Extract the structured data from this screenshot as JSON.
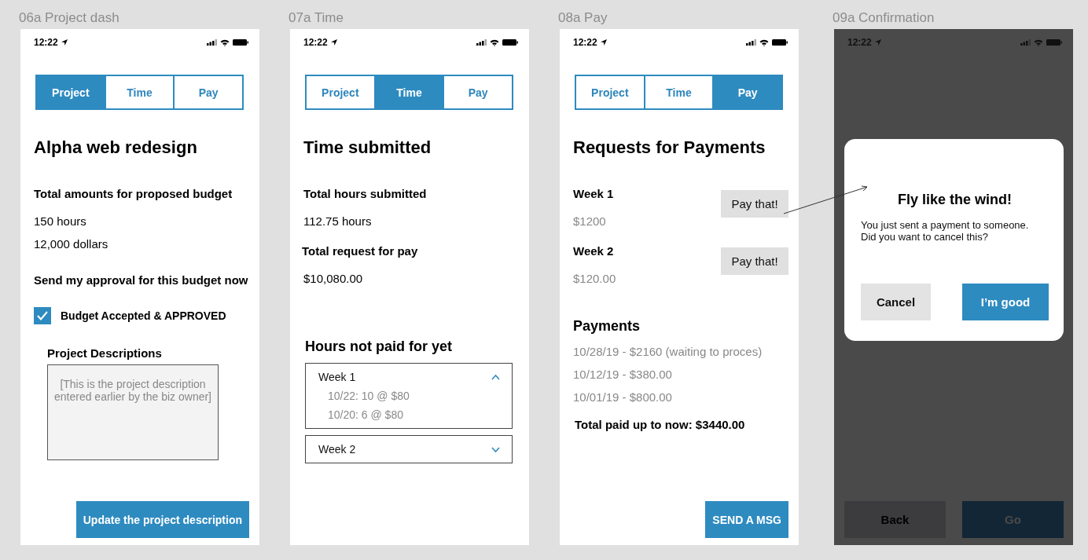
{
  "artboards": [
    {
      "label": "06a Project dash",
      "kind": "project",
      "overlay": false,
      "status_time": "12:22",
      "tabs": [
        {
          "label": "Project",
          "selected": true
        },
        {
          "label": "Time",
          "selected": false
        },
        {
          "label": "Pay",
          "selected": false
        }
      ],
      "title": "Alpha web redesign",
      "budget_heading": "Total amounts for proposed budget",
      "budget_lines": [
        "150 hours",
        "12,000 dollars"
      ],
      "approval_heading": "Send my approval for this budget now",
      "checkbox": {
        "label": "Budget Accepted & APPROVED",
        "checked": true
      },
      "description_heading": "Project Descriptions",
      "description_text": "[This is the project description entered earlier by the biz owner]",
      "action_button": "Update the project description"
    },
    {
      "label": "07a Time",
      "kind": "time",
      "overlay": false,
      "status_time": "12:22",
      "tabs": [
        {
          "label": "Project",
          "selected": false
        },
        {
          "label": "Time",
          "selected": true
        },
        {
          "label": "Pay",
          "selected": false
        }
      ],
      "title": "Time submitted",
      "hours_heading": "Total hours submitted",
      "hours_value": "112.75 hours",
      "pay_heading": "Total request for pay",
      "pay_value": "$10,080.00",
      "unpaid_heading": "Hours not paid for yet",
      "weeks": [
        {
          "label": "Week 1",
          "expanded": true,
          "entries": [
            "10/22: 10 @ $80",
            "10/20: 6 @ $80"
          ]
        },
        {
          "label": "Week 2",
          "expanded": false
        }
      ]
    },
    {
      "label": "08a Pay",
      "kind": "pay",
      "overlay": false,
      "status_time": "12:22",
      "tabs": [
        {
          "label": "Project",
          "selected": false
        },
        {
          "label": "Time",
          "selected": false
        },
        {
          "label": "Pay",
          "selected": true
        }
      ],
      "title": "Requests for Payments",
      "requests": [
        {
          "week": "Week 1",
          "amount": "$1200",
          "button": "Pay that!"
        },
        {
          "week": "Week 2",
          "amount": "$120.00",
          "button": "Pay that!"
        }
      ],
      "payments_heading": "Payments",
      "payments": [
        "10/28/19 - $2160 (waiting to proces)",
        "10/12/19 - $380.00",
        "10/01/19 - $800.00"
      ],
      "total": "Total paid up to now: $3440.00",
      "action_button": "SEND A MSG"
    },
    {
      "label": "09a Confirmation",
      "kind": "confirmation",
      "overlay": true,
      "status_time": "12:22",
      "dialog": {
        "title": "Fly like the wind!",
        "message": "You just sent a payment to someone.\nDid you want to cancel this?",
        "buttons": [
          {
            "label": "Cancel",
            "kind": "secondary"
          },
          {
            "label": "I’m good",
            "kind": "primary"
          }
        ]
      },
      "footer_buttons": [
        {
          "label": "Back",
          "kind": "secondary"
        },
        {
          "label": "Go",
          "kind": "primary"
        }
      ]
    }
  ]
}
